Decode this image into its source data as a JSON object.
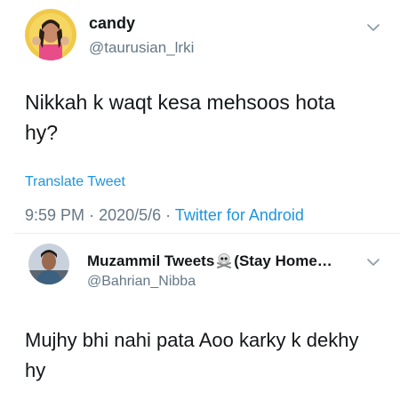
{
  "main_tweet": {
    "display_name": "candy",
    "handle": "@taurusian_lrki",
    "text": "Nikkah k waqt kesa mehsoos hota hy?",
    "translate_label": "Translate Tweet",
    "time": "9:59 PM",
    "date": "2020/5/6",
    "separator": "·",
    "source": "Twitter for Android"
  },
  "reply_tweet": {
    "display_name_part1": "Muzammil Tweets",
    "display_name_part2": "(Stay Home…",
    "name_emoji": "skull-and-crossbones-icon",
    "handle": "@Bahrian_Nibba",
    "text": "Mujhy bhi nahi pata Aoo karky k dekhy hy"
  },
  "colors": {
    "text": "#14171a",
    "secondary": "#657786",
    "link": "#1b95e0",
    "divider": "#e6ecf0"
  }
}
